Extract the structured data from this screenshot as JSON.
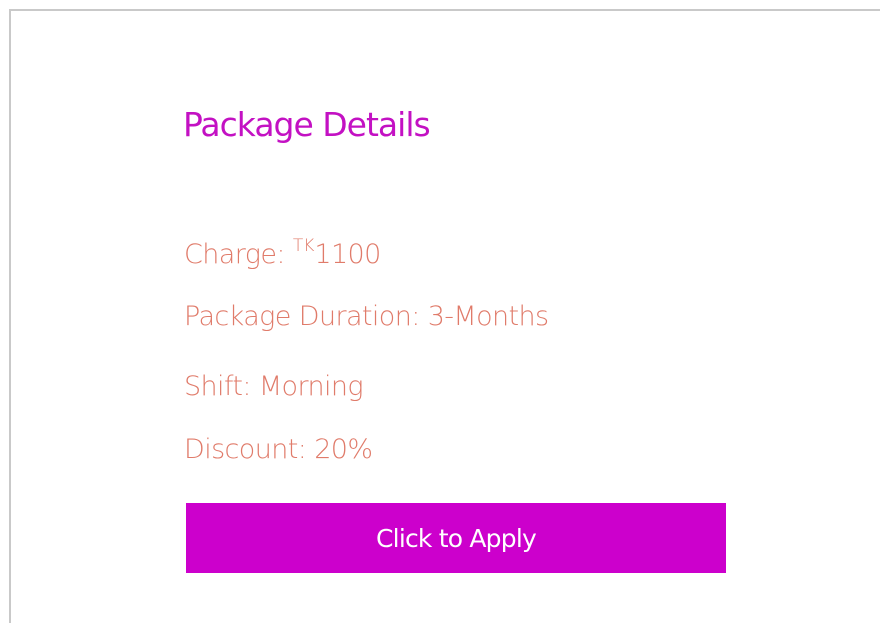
{
  "package": {
    "title": "Package Details",
    "charge_label": "Charge:",
    "currency": "TK",
    "charge_amount": "1100",
    "duration_text": "Package Duration: 3-Months",
    "shift_text": "Shift: Morning",
    "discount_text": "Discount: 20%",
    "apply_label": "Click to Apply"
  },
  "colors": {
    "title": "#c311c3",
    "detail_text": "#e07b6a",
    "button_bg": "#cc00cc",
    "button_text": "#ffffff",
    "panel_border": "#c9c9c9"
  }
}
